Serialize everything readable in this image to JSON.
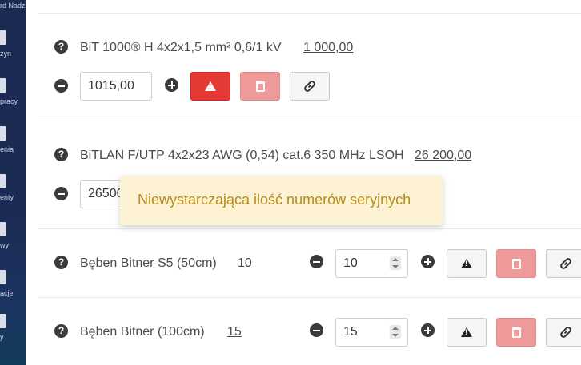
{
  "sidebar": {
    "top_label": "rd Nadz",
    "items": [
      {
        "label": "zyn",
        "icon": "document-icon"
      },
      {
        "label": "pracy",
        "icon": "briefcase-icon"
      },
      {
        "label": "enia",
        "icon": "list-icon"
      },
      {
        "label": "enty",
        "icon": "file-icon"
      },
      {
        "label": "wy",
        "icon": "box-icon"
      },
      {
        "label": "acje",
        "icon": "alert-icon"
      },
      {
        "label": "y",
        "icon": "menu-icon"
      }
    ]
  },
  "items": [
    {
      "name": "BiT 1000® H 4x2x1,5 mm² 0,6/1 kV",
      "required_qty": "1 000,00",
      "input_value": "1015,00",
      "warn_active": true
    },
    {
      "name": "BiTLAN F/UTP 4x2x23 AWG (0,54) cat.6 350 MHz LSOH",
      "required_qty": "26 200,00",
      "input_value": "26500"
    },
    {
      "name": "Bęben Bitner S5 (50cm)",
      "required_qty": "10",
      "input_value": "10"
    },
    {
      "name": "Bęben Bitner (100cm)",
      "required_qty": "15",
      "input_value": "15"
    }
  ],
  "toast": {
    "message": "Niewystarczająca ilość numerów seryjnych"
  },
  "colors": {
    "danger": "#e53935",
    "danger_light": "#ef9a9a",
    "toast_bg": "#fdf3d4",
    "toast_text": "#b68b1a",
    "sidebar_bg": "#1c2b55"
  }
}
